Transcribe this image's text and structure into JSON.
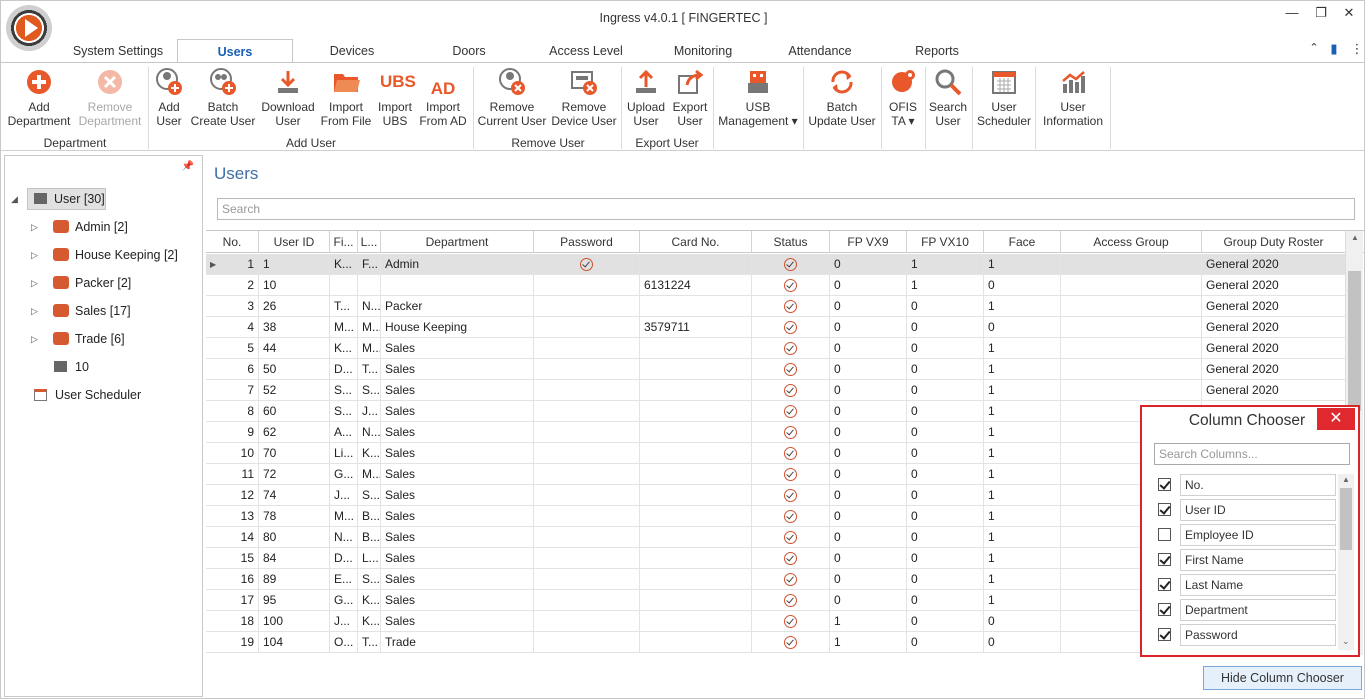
{
  "window": {
    "title": "Ingress v4.0.1 [ FINGERTEC ]"
  },
  "tabs": [
    "System Settings",
    "Users",
    "Devices",
    "Doors",
    "Access Level",
    "Monitoring",
    "Attendance",
    "Reports"
  ],
  "ribbon": {
    "add_department": "Add\nDepartment",
    "remove_department": "Remove\nDepartment",
    "group_department": "Department",
    "add_user": "Add\nUser",
    "batch_create": "Batch\nCreate User",
    "download_user": "Download\nUser",
    "import_file": "Import\nFrom File",
    "import_ubs": "Import\nUBS",
    "import_ad": "Import\nFrom AD",
    "group_add_user": "Add User",
    "remove_current": "Remove\nCurrent User",
    "remove_device": "Remove\nDevice User",
    "group_remove": "Remove User",
    "upload_user": "Upload\nUser",
    "export_user": "Export\nUser",
    "group_export": "Export User",
    "usb_mgmt": "USB\nManagement ▾",
    "batch_update": "Batch\nUpdate User",
    "ofis_ta": "OFIS\nTA ▾",
    "search_user": "Search\nUser",
    "user_scheduler": "User\nScheduler",
    "user_information": "User\nInformation",
    "ubs_text": "UBS",
    "ad_text": "AD"
  },
  "tree": {
    "root": "User [30]",
    "items": [
      "Admin [2]",
      "House Keeping [2]",
      "Packer [2]",
      "Sales [17]",
      "Trade [6]"
    ],
    "loose": "10",
    "scheduler": "User Scheduler"
  },
  "main": {
    "title": "Users",
    "search_placeholder": "Search"
  },
  "grid": {
    "headers": [
      "No.",
      "User ID",
      "Fi...",
      "L...",
      "Department",
      "Password",
      "Card No.",
      "Status",
      "FP VX9",
      "FP VX10",
      "Face",
      "Access Group",
      "Group Duty Roster"
    ],
    "rows": [
      [
        "1",
        "1",
        "K...",
        "F...",
        "Admin",
        "✓",
        "",
        "✓",
        "0",
        "1",
        "1",
        "",
        "General 2020"
      ],
      [
        "2",
        "10",
        "",
        "",
        "",
        "",
        "6131224",
        "✓",
        "0",
        "1",
        "0",
        "",
        "General 2020"
      ],
      [
        "3",
        "26",
        "T...",
        "N...",
        "Packer",
        "",
        "",
        "✓",
        "0",
        "0",
        "1",
        "",
        "General 2020"
      ],
      [
        "4",
        "38",
        "M...",
        "M...",
        "House Keeping",
        "",
        "3579711",
        "✓",
        "0",
        "0",
        "0",
        "",
        "General 2020"
      ],
      [
        "5",
        "44",
        "K...",
        "M...",
        "Sales",
        "",
        "",
        "✓",
        "0",
        "0",
        "1",
        "",
        "General 2020"
      ],
      [
        "6",
        "50",
        "D...",
        "T...",
        "Sales",
        "",
        "",
        "✓",
        "0",
        "0",
        "1",
        "",
        "General 2020"
      ],
      [
        "7",
        "52",
        "S...",
        "S...",
        "Sales",
        "",
        "",
        "✓",
        "0",
        "0",
        "1",
        "",
        "General 2020"
      ],
      [
        "8",
        "60",
        "S...",
        "J...",
        "Sales",
        "",
        "",
        "✓",
        "0",
        "0",
        "1",
        "",
        ""
      ],
      [
        "9",
        "62",
        "A...",
        "N...",
        "Sales",
        "",
        "",
        "✓",
        "0",
        "0",
        "1",
        "",
        ""
      ],
      [
        "10",
        "70",
        "Li...",
        "K...",
        "Sales",
        "",
        "",
        "✓",
        "0",
        "0",
        "1",
        "",
        ""
      ],
      [
        "11",
        "72",
        "G...",
        "M...",
        "Sales",
        "",
        "",
        "✓",
        "0",
        "0",
        "1",
        "",
        ""
      ],
      [
        "12",
        "74",
        "J...",
        "S...",
        "Sales",
        "",
        "",
        "✓",
        "0",
        "0",
        "1",
        "",
        ""
      ],
      [
        "13",
        "78",
        "M...",
        "B...",
        "Sales",
        "",
        "",
        "✓",
        "0",
        "0",
        "1",
        "",
        ""
      ],
      [
        "14",
        "80",
        "N...",
        "B...",
        "Sales",
        "",
        "",
        "✓",
        "0",
        "0",
        "1",
        "",
        ""
      ],
      [
        "15",
        "84",
        "D...",
        "L...",
        "Sales",
        "",
        "",
        "✓",
        "0",
        "0",
        "1",
        "",
        ""
      ],
      [
        "16",
        "89",
        "E...",
        "S...",
        "Sales",
        "",
        "",
        "✓",
        "0",
        "0",
        "1",
        "",
        ""
      ],
      [
        "17",
        "95",
        "G...",
        "K...",
        "Sales",
        "",
        "",
        "✓",
        "0",
        "0",
        "1",
        "",
        ""
      ],
      [
        "18",
        "100",
        "J...",
        "K...",
        "Sales",
        "",
        "",
        "✓",
        "1",
        "0",
        "0",
        "",
        ""
      ],
      [
        "19",
        "104",
        "O...",
        "T...",
        "Trade",
        "",
        "",
        "✓",
        "1",
        "0",
        "0",
        "",
        ""
      ]
    ]
  },
  "chooser": {
    "title": "Column Chooser",
    "search_placeholder": "Search Columns...",
    "close": "✕",
    "columns": [
      {
        "label": "No.",
        "checked": true
      },
      {
        "label": "User ID",
        "checked": true
      },
      {
        "label": "Employee ID",
        "checked": false
      },
      {
        "label": "First Name",
        "checked": true
      },
      {
        "label": "Last Name",
        "checked": true
      },
      {
        "label": "Department",
        "checked": true
      },
      {
        "label": "Password",
        "checked": true
      }
    ]
  },
  "hide_button": "Hide Column Chooser",
  "colors": {
    "accent": "#e05a20",
    "brand_blue": "#1a5fb4",
    "close_red": "#e0292e"
  }
}
